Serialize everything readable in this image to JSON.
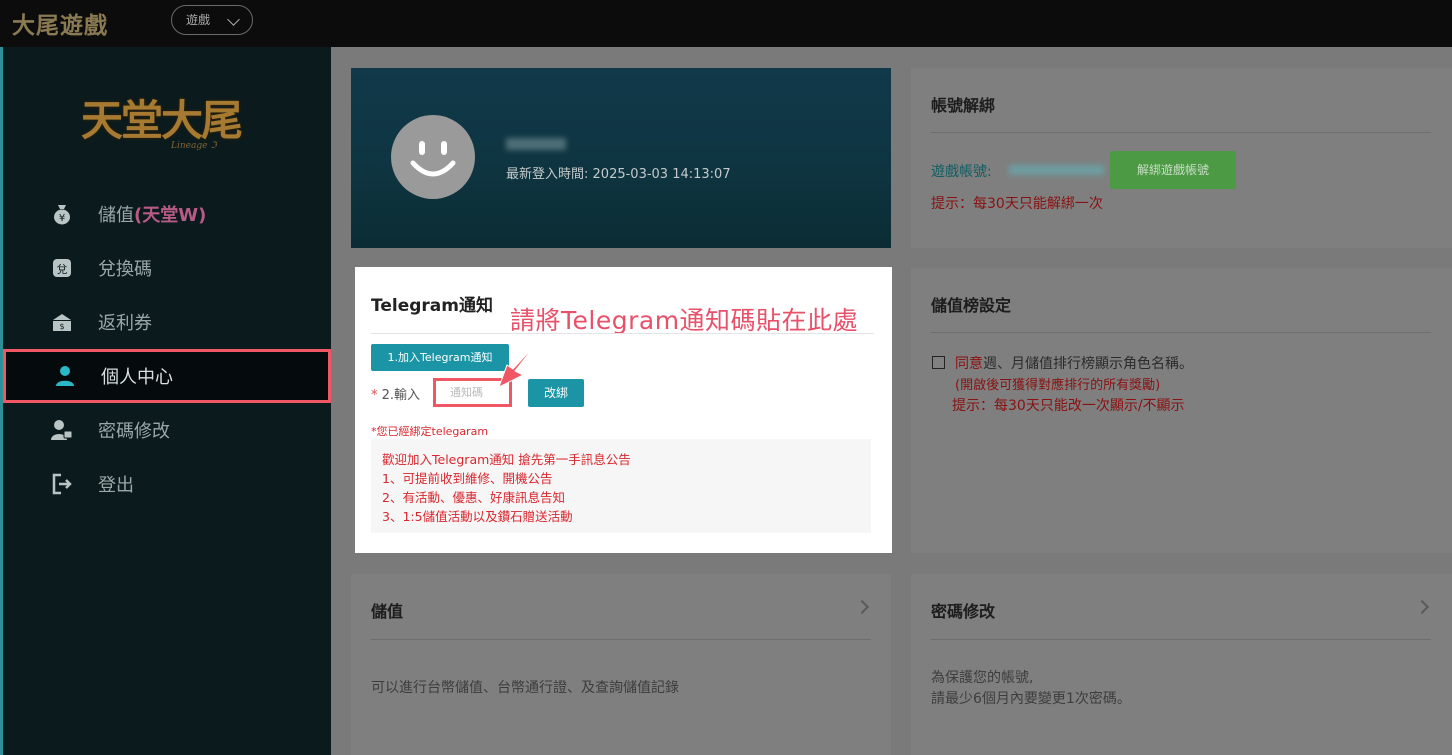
{
  "header": {
    "brand": "大尾遊戲",
    "game_select": "遊戲"
  },
  "sidebar": {
    "logo_text": "天堂大尾",
    "logo_sub": "Lineage ℑ",
    "items": [
      {
        "icon": "money-bag-icon",
        "label": "儲值",
        "highlight": "(天堂W)"
      },
      {
        "icon": "exchange-icon",
        "label": "兌換碼",
        "icon_glyph": "兌"
      },
      {
        "icon": "coupon-icon",
        "label": "返利券"
      },
      {
        "icon": "user-icon",
        "label": "個人中心",
        "active": true
      },
      {
        "icon": "password-icon",
        "label": "密碼修改"
      },
      {
        "icon": "logout-icon",
        "label": "登出"
      }
    ]
  },
  "profile": {
    "last_login_label": "最新登入時間:",
    "last_login_value": "2025-03-03 14:13:07"
  },
  "telegram": {
    "title": "Telegram通知",
    "join_button": "1.加入Telegram通知",
    "input_required_mark": "*",
    "input_label": "2.輸入",
    "input_placeholder": "通知碼",
    "rebind_button": "改綁",
    "bound_note": "*您已經綁定telegaram",
    "info_lines": [
      "歡迎加入Telegram通知 搶先第一手訊息公告",
      "1、可提前收到維修、開機公告",
      "2、有活動、優惠、好康訊息告知",
      "3、1:5儲值活動以及鑽石贈送活動"
    ],
    "callout": "請將Telegram通知碼貼在此處"
  },
  "unbind": {
    "title": "帳號解綁",
    "account_label": "遊戲帳號:",
    "button": "解綁遊戲帳號",
    "hint": "提示：每30天只能解綁一次"
  },
  "rank": {
    "title": "儲值榜設定",
    "agree": "同意",
    "line1_rest": "週、月儲值排行榜顯示角色名稱。",
    "line2": "(開啟後可獲得對應排行的所有獎勵)",
    "line3": "提示：每30天只能改一次顯示/不顯示"
  },
  "deposit": {
    "title": "儲值",
    "desc": "可以進行台幣儲值、台幣通行證、及查詢儲值記錄"
  },
  "password": {
    "title": "密碼修改",
    "line1": "為保護您的帳號,",
    "line2": "請最少6個月內要變更1次密碼。"
  },
  "colors": {
    "accent": "#1b95a6",
    "highlight_border": "#ee5763",
    "alert_red": "#d9272e",
    "unbind_green": "#4d9a45"
  }
}
